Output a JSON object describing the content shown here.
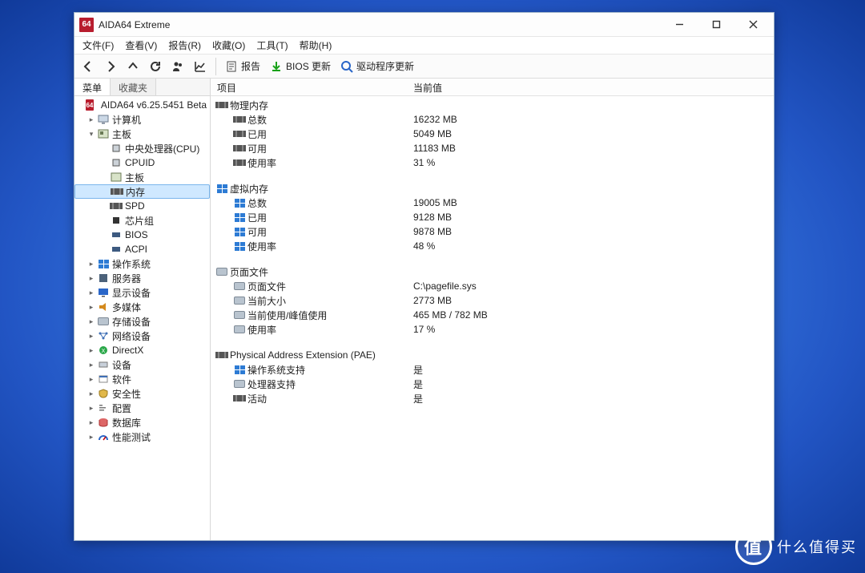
{
  "title": "AIDA64 Extreme",
  "logo_text": "64",
  "menu": [
    "文件(F)",
    "查看(V)",
    "报告(R)",
    "收藏(O)",
    "工具(T)",
    "帮助(H)"
  ],
  "toolbar": {
    "report": "报告",
    "bios_update": "BIOS 更新",
    "driver_update": "驱动程序更新"
  },
  "sidebar": {
    "tabs": {
      "menu": "菜单",
      "fav": "收藏夹"
    },
    "root": "AIDA64 v6.25.5451 Beta",
    "nodes": {
      "computer": "计算机",
      "motherboard": "主板",
      "cpu": "中央处理器(CPU)",
      "cpuid": "CPUID",
      "mb": "主板",
      "memory": "内存",
      "spd": "SPD",
      "chipset": "芯片组",
      "bios": "BIOS",
      "acpi": "ACPI",
      "os": "操作系统",
      "server": "服务器",
      "display": "显示设备",
      "multimedia": "多媒体",
      "storage": "存储设备",
      "network": "网络设备",
      "directx": "DirectX",
      "devices": "设备",
      "software": "软件",
      "security": "安全性",
      "config": "配置",
      "database": "数据库",
      "benchmark": "性能测试"
    }
  },
  "columns": {
    "item": "项目",
    "value": "当前值"
  },
  "sections": [
    {
      "title": "物理内存",
      "icon": "ram",
      "rows": [
        {
          "icon": "ram",
          "label": "总数",
          "value": "16232 MB"
        },
        {
          "icon": "ram",
          "label": "已用",
          "value": "5049 MB"
        },
        {
          "icon": "ram",
          "label": "可用",
          "value": "11183 MB"
        },
        {
          "icon": "ram",
          "label": "使用率",
          "value": "31 %"
        }
      ]
    },
    {
      "title": "虚拟内存",
      "icon": "win",
      "rows": [
        {
          "icon": "win",
          "label": "总数",
          "value": "19005 MB"
        },
        {
          "icon": "win",
          "label": "已用",
          "value": "9128 MB"
        },
        {
          "icon": "win",
          "label": "可用",
          "value": "9878 MB"
        },
        {
          "icon": "win",
          "label": "使用率",
          "value": "48 %"
        }
      ]
    },
    {
      "title": "页面文件",
      "icon": "disk",
      "rows": [
        {
          "icon": "disk",
          "label": "页面文件",
          "value": "C:\\pagefile.sys"
        },
        {
          "icon": "disk",
          "label": "当前大小",
          "value": "2773 MB"
        },
        {
          "icon": "disk",
          "label": "当前使用/峰值使用",
          "value": "465 MB / 782 MB"
        },
        {
          "icon": "disk",
          "label": "使用率",
          "value": "17 %"
        }
      ]
    },
    {
      "title": "Physical Address Extension (PAE)",
      "icon": "ram",
      "rows": [
        {
          "icon": "win",
          "label": "操作系统支持",
          "value": "是"
        },
        {
          "icon": "disk",
          "label": "处理器支持",
          "value": "是"
        },
        {
          "icon": "ram",
          "label": "活动",
          "value": "是"
        }
      ]
    }
  ],
  "watermark": {
    "badge": "值",
    "text": "什么值得买"
  }
}
